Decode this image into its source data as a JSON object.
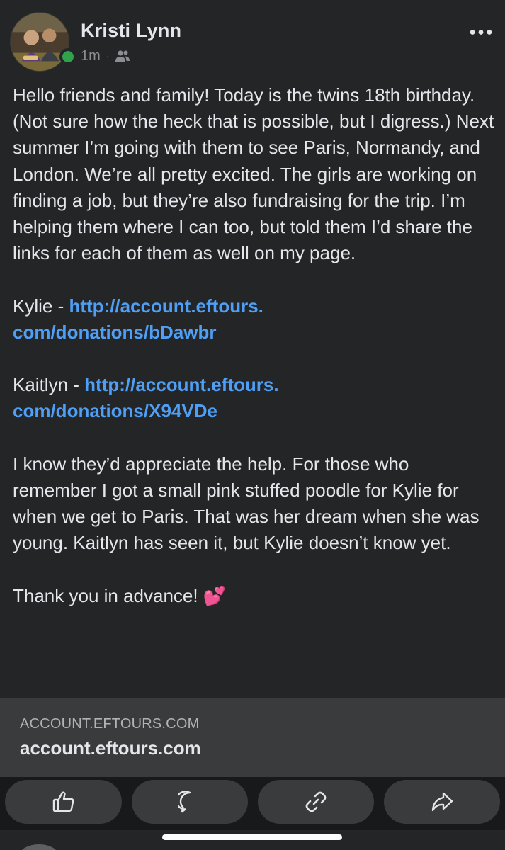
{
  "post": {
    "author": "Kristi Lynn",
    "time": "1m",
    "separator": "·",
    "audience_icon": "friends-icon",
    "more_icon": "more-dots-icon",
    "paragraphs": {
      "p1": "Hello friends and family! Today is the twins 18th birthday. (Not sure how the heck that is possible, but I digress.) Next summer I’m going with them to see Paris, Normandy, and London. We’re all pretty excited. The girls are working on finding a job, but they’re also fundraising for the trip. I’m helping them where I can too, but told them I’d share the links for each of them as well on my page.",
      "kylie_prefix": "Kylie - ",
      "kylie_link_1": "http://account.eftours.",
      "kylie_link_2": "com/donations/bDawbr",
      "kaitlyn_prefix": "Kaitlyn - ",
      "kaitlyn_link_1": "http://account.eftours.",
      "kaitlyn_link_2": "com/donations/X94VDe",
      "p4": "I know they’d appreciate the help. For those who remember I got a small pink stuffed poodle for Kylie for when we get to Paris. That was her dream when she was young. Kaitlyn has seen it, but Kylie doesn’t know yet.",
      "p5": "Thank you in advance!",
      "emoji": "💕"
    }
  },
  "link_preview": {
    "domain": "ACCOUNT.EFTOURS.COM",
    "title": "account.eftours.com"
  },
  "actions": [
    {
      "name": "like",
      "icon": "thumbs-up-icon"
    },
    {
      "name": "comment",
      "icon": "comment-icon"
    },
    {
      "name": "copy-link",
      "icon": "link-icon"
    },
    {
      "name": "share",
      "icon": "share-icon"
    }
  ],
  "colors": {
    "background": "#242526",
    "text": "#e4e6eb",
    "secondary_text": "#8a8d91",
    "link": "#4e9ff5",
    "online": "#31a24c",
    "preview_bg": "#3a3b3c",
    "action_bar_bg": "#18191a",
    "pink_heart": "#ff5fa2"
  }
}
